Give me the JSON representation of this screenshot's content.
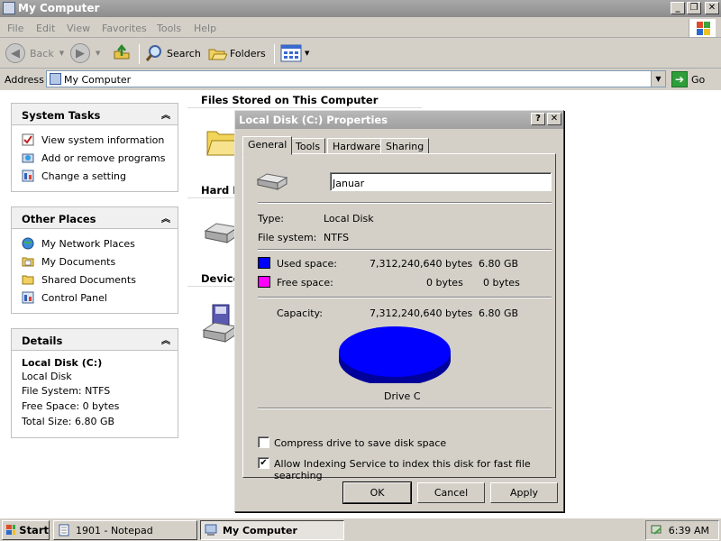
{
  "window": {
    "title": "My Computer"
  },
  "menu": [
    "File",
    "Edit",
    "View",
    "Favorites",
    "Tools",
    "Help"
  ],
  "toolbar": {
    "back": "Back",
    "search": "Search",
    "folders": "Folders"
  },
  "address": {
    "label": "Address",
    "value": "My Computer",
    "go": "Go"
  },
  "tasks": {
    "system": {
      "title": "System Tasks",
      "items": [
        "View system information",
        "Add or remove programs",
        "Change a setting"
      ]
    },
    "other": {
      "title": "Other Places",
      "items": [
        "My Network Places",
        "My Documents",
        "Shared Documents",
        "Control Panel"
      ]
    },
    "details": {
      "title": "Details",
      "name": "Local Disk (C:)",
      "lines": [
        "Local Disk",
        "File System: NTFS",
        "Free Space: 0 bytes",
        "Total Size: 6.80 GB"
      ]
    }
  },
  "main": {
    "groups": [
      "Files Stored on This Computer",
      "Hard D",
      "Device"
    ]
  },
  "dialog": {
    "title": "Local Disk (C:) Properties",
    "tabs": [
      "General",
      "Tools",
      "Hardware",
      "Sharing"
    ],
    "name_value": "Januar",
    "type_label": "Type:",
    "type_value": "Local Disk",
    "fs_label": "File system:",
    "fs_value": "NTFS",
    "used_label": "Used space:",
    "used_bytes": "7,312,240,640 bytes",
    "used_gb": "6.80 GB",
    "free_label": "Free space:",
    "free_bytes": "0 bytes",
    "free_gb": "0 bytes",
    "cap_label": "Capacity:",
    "cap_bytes": "7,312,240,640 bytes",
    "cap_gb": "6.80 GB",
    "drive_label": "Drive C",
    "compress_label": "Compress drive to save disk space",
    "index_label": "Allow Indexing Service to index this disk for fast file searching",
    "index_checked": "✔",
    "ok": "OK",
    "cancel": "Cancel",
    "apply": "Apply",
    "used_color": "#0000ff",
    "free_color": "#ff00ff"
  },
  "taskbar": {
    "start": "Start",
    "notepad": "1901 - Notepad",
    "mycomputer": "My Computer",
    "time": "6:39 AM"
  }
}
